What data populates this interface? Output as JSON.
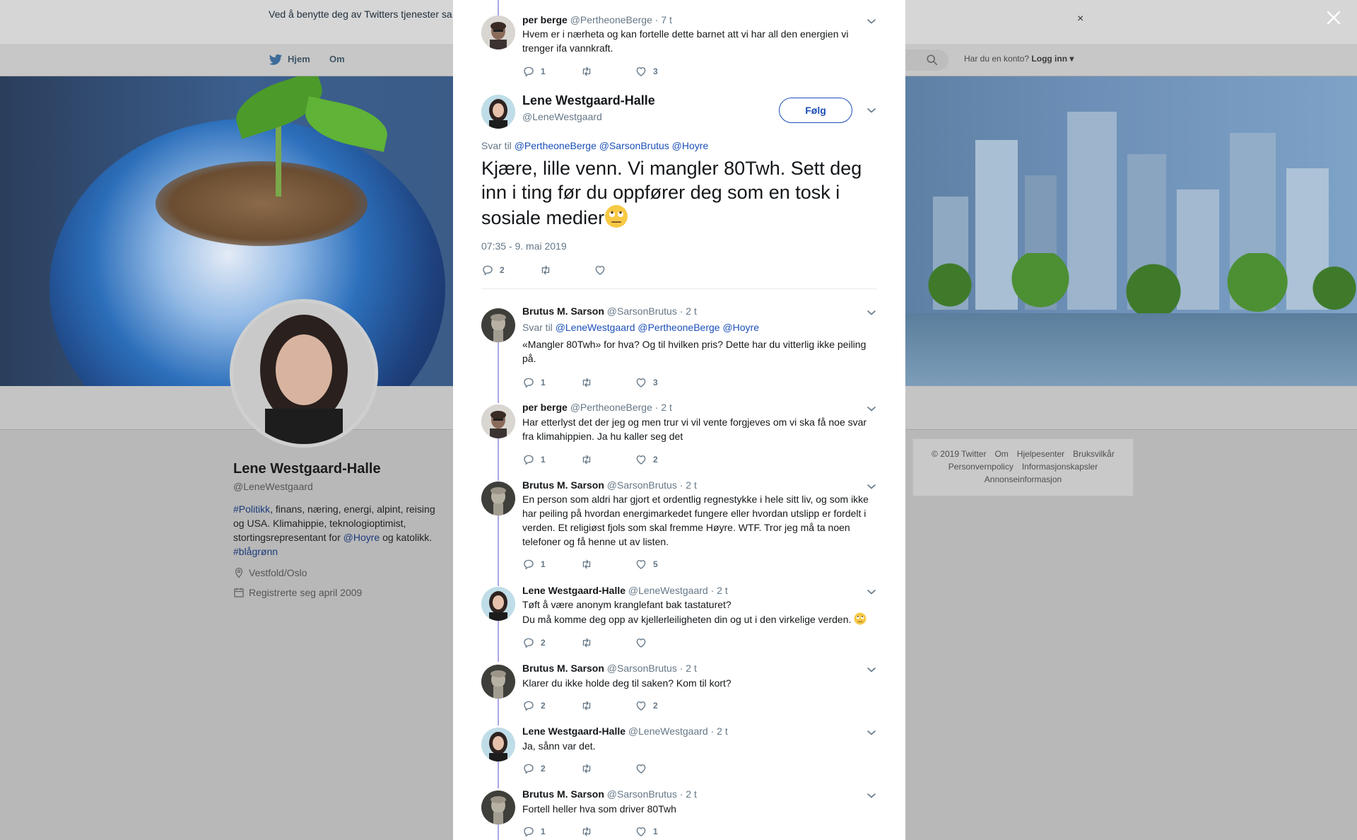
{
  "cookie": {
    "text": "Ved å benytte deg av Twitters tjenester sa… informasjonskapsler til bl.a. analyser, personalisering og annonser.",
    "close": "×"
  },
  "nav": {
    "home": "Hjem",
    "about": "Om",
    "account_q": "Har du en konto?",
    "login": "Logg inn"
  },
  "profile": {
    "name": "Lene Westgaard-Halle",
    "handle": "@LeneWestgaard",
    "bio_tag1": "#Politikk",
    "bio_mid": ", finans, næring, energi, alpint, reising og USA. Klimahippie, teknologioptimist, stortingsrepresentant for ",
    "bio_mention": "@Hoyre",
    "bio_and": " og katolikk. ",
    "bio_tag2": "#blågrønn",
    "location": "Vestfold/Oslo",
    "joined": "Registrerte seg april 2009"
  },
  "footer": {
    "links": [
      "© 2019 Twitter",
      "Om",
      "Hjelpesenter",
      "Bruksvilkår",
      "Personvernpolicy",
      "Informasjonskapsler",
      "Annonseinformasjon"
    ]
  },
  "modal": {
    "parent": {
      "name": "per berge",
      "handle": "@PertheoneBerge",
      "time": "· 7 t",
      "text": "Hvem er i nærheta og kan fortelle dette barnet att vi har all den energien vi trenger ifa vannkraft.",
      "replies": "1",
      "retweets": "",
      "likes": "3"
    },
    "main": {
      "name": "Lene Westgaard-Halle",
      "handle": "@LeneWestgaard",
      "follow": "Følg",
      "reply_label": "Svar til",
      "reply_mentions": "@PertheoneBerge @SarsonBrutus @Hoyre",
      "text": "Kjære, lille venn. Vi mangler 80Twh. Sett deg inn i ting før du oppfører deg som en tosk i sosiale medier",
      "timestamp": "07:35 - 9. mai 2019",
      "replies": "2",
      "retweets": "",
      "likes": ""
    },
    "replies": [
      {
        "name": "Brutus M. Sarson",
        "handle": "@SarsonBrutus",
        "time": "· 2 t",
        "reply_label": "Svar til",
        "reply_mentions": "@LeneWestgaard @PertheoneBerge @Hoyre",
        "text": "«Mangler 80Twh» for hva? Og til hvilken pris? Dette har du vitterlig ikke peiling på.",
        "replies": "1",
        "retweets": "",
        "likes": "3"
      },
      {
        "name": "per berge",
        "handle": "@PertheoneBerge",
        "time": "· 2 t",
        "text": "Har etterlyst det der jeg og men trur vi vil vente forgjeves om vi ska få noe svar fra klimahippien. Ja hu kaller seg det",
        "replies": "1",
        "retweets": "",
        "likes": "2"
      },
      {
        "name": "Brutus M. Sarson",
        "handle": "@SarsonBrutus",
        "time": "· 2 t",
        "text": "En person som aldri har gjort et ordentlig regnestykke i hele sitt liv, og som ikke har peiling på hvordan energimarkedet fungere eller hvordan utslipp er fordelt i verden. Et religiøst fjols som skal fremme Høyre. WTF. Tror jeg må ta noen telefoner og få henne ut av listen.",
        "replies": "1",
        "retweets": "",
        "likes": "5"
      },
      {
        "name": "Lene Westgaard-Halle",
        "handle": "@LeneWestgaard",
        "time": "· 2 t",
        "text1": "Tøft å være anonym kranglefant bak tastaturet?",
        "text2": "Du må komme deg opp av kjellerleiligheten din og ut i den virkelige verden.",
        "replies": "2",
        "retweets": "",
        "likes": ""
      },
      {
        "name": "Brutus M. Sarson",
        "handle": "@SarsonBrutus",
        "time": "· 2 t",
        "text": "Klarer du ikke holde deg til saken? Kom til kort?",
        "replies": "2",
        "retweets": "",
        "likes": "2"
      },
      {
        "name": "Lene Westgaard-Halle",
        "handle": "@LeneWestgaard",
        "time": "· 2 t",
        "text": "Ja, sånn var det.",
        "replies": "2",
        "retweets": "",
        "likes": ""
      },
      {
        "name": "Brutus M. Sarson",
        "handle": "@SarsonBrutus",
        "time": "· 2 t",
        "text": "Fortell heller hva som driver 80Twh",
        "replies": "1",
        "retweets": "",
        "likes": "1"
      }
    ]
  },
  "colors": {
    "link": "#1b4fb8",
    "thread_line": "#a9a6e4",
    "muted": "#657786"
  },
  "icons": [
    "reply-icon",
    "retweet-icon",
    "like-icon",
    "chevron-down-icon",
    "close-icon",
    "location-icon",
    "calendar-icon",
    "twitter-bird-icon",
    "search-icon"
  ]
}
